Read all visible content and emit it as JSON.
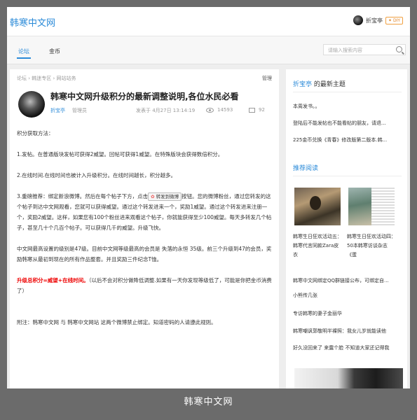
{
  "app": {
    "logo": "韩寒中文网",
    "username": "折宝亭",
    "diy_label": "DIY"
  },
  "nav": {
    "tabs": [
      {
        "label": "论坛",
        "active": true
      },
      {
        "label": "金币",
        "active": false
      }
    ],
    "search_placeholder": "请输入搜索内容"
  },
  "post": {
    "breadcrumb": [
      "论坛",
      "韩迷专区",
      "网站站务"
    ],
    "manage_label": "管理",
    "title": "韩寒中文网升级积分的最新调整说明,各位水民必看",
    "author": "折宝亭",
    "role": "管理员",
    "posted": "发表于 4月27日 13:14:19",
    "views": "14593",
    "replies": "92",
    "share_label": "转发到微博",
    "body": {
      "heading": "积分获取方法：",
      "p1": "1.发帖。在普通版块发帖可获得2威望。回帖可获得1威望。在特殊版块会获得数倍积分。",
      "p2": "2.在线时间.在线时间也被计入升级积分。在线时间越长，积分越多。",
      "p3_before": "3.重磅推荐：绑定新浪微博。然后在每个帖子下方，点击",
      "p3_after": "按钮。您的微博粉丝，通过您转发的这个帖子到达中文网观看，您就可以获得威望。通过这个转发进来一个，奖励1威望。通过这个转发进来注册一个，奖励2威望。这样，如果您有100个粉丝进来观看这个帖子，你就能获得至少100威望。每天多转发几个帖子，甚至几十个几百个帖子。可以获得几千的威望。升级飞快。",
      "p4": "中文网最高设置的级别是47级。目前中文网等级最高的会员是 失落的永恒  35级。前三个升级到47的会员，奖励韩寒从最初到现在的所有作品整套。并且奖励三件纪念T恤。",
      "p5_red": "升级总积分=威望+在线时间。",
      "p5_rest": "（以后不会对积分做降低调整.如果有一天你发现等级低了，可能是你把金币消费了）",
      "p6": "附注：韩寒中文网  与  韩寒中文网站 这两个微博禁止绑定。知道密码的人请遵此规则。"
    }
  },
  "sidebar": {
    "latest_user": "折宝亭",
    "latest_suffix": "的最新主题",
    "latest": [
      "本周发书。。",
      "登陆后不能发帖也不能看帖的朋友，请退...",
      "225金币兑换《青春》修改版第二版本.韩..."
    ],
    "recommend_title": "推荐阅读",
    "thumb_captions": [
      "韩寒生日狂欢活动五：韩寒代言同款Zara皮衣",
      "韩寒生日狂欢活动四：50本韩寒访谈杂志《蛋"
    ],
    "recommend": [
      "韩寒中文网绑定QQ群链接公布，可绑定自...",
      "小熊传几张",
      "专访韩寒的妻子金丽华",
      "韩寒嘲讽郭敬明半裸照：我女儿岁就能读他",
      "好久没回来了 来露个脸 不知道大家还记得我"
    ]
  },
  "footer": {
    "caption": "韩寒中文网"
  }
}
